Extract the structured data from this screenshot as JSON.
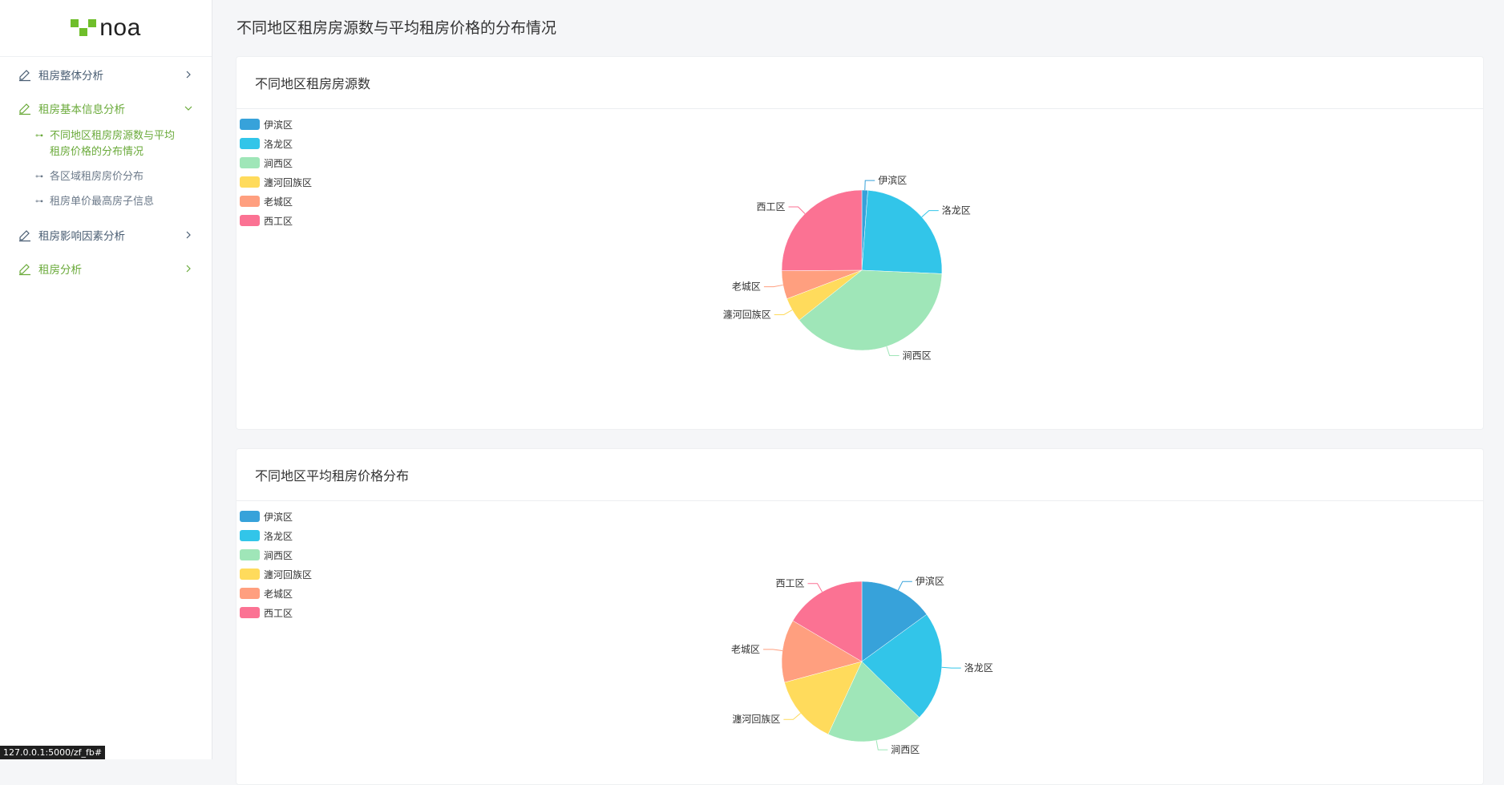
{
  "app": {
    "logo_text": "noa",
    "status_url": "127.0.0.1:5000/zf_fb#"
  },
  "sidebar": {
    "items": [
      {
        "label": "租房整体分析",
        "icon": "edit-icon",
        "chevron": "chevron-right-icon"
      },
      {
        "label": "租房基本信息分析",
        "icon": "edit-icon",
        "chevron": "chevron-down-icon",
        "expanded": true,
        "children": [
          {
            "label": "不同地区租房房源数与平均租房价格的分布情况",
            "active": true
          },
          {
            "label": "各区域租房房价分布"
          },
          {
            "label": "租房单价最高房子信息"
          }
        ]
      },
      {
        "label": "租房影响因素分析",
        "icon": "edit-icon",
        "chevron": "chevron-right-icon"
      },
      {
        "label": "租房分析",
        "icon": "edit-icon",
        "chevron": "chevron-right-icon"
      }
    ]
  },
  "page": {
    "title": "不同地区租房房源数与平均租房价格的分布情况"
  },
  "chart_data": [
    {
      "type": "pie",
      "title": "不同地区租房房源数",
      "legend_position": "top-left",
      "categories": [
        "伊滨区",
        "涧西区",
        "洛龙区",
        "瀍河回族区",
        "老城区",
        "西工区"
      ],
      "legend": [
        "伊滨区",
        "洛龙区",
        "涧西区",
        "瀍河回族区",
        "老城区",
        "西工区"
      ],
      "colors": {
        "伊滨区": "#37a2da",
        "洛龙区": "#32c5e9",
        "涧西区": "#9fe6b8",
        "瀍河回族区": "#ffdb5c",
        "老城区": "#ff9f7f",
        "西工区": "#fb7293"
      },
      "slices": [
        {
          "name": "伊滨区",
          "value": 1.2
        },
        {
          "name": "洛龙区",
          "value": 24.5
        },
        {
          "name": "涧西区",
          "value": 38.6
        },
        {
          "name": "瀍河回族区",
          "value": 4.9
        },
        {
          "name": "老城区",
          "value": 5.7
        },
        {
          "name": "西工区",
          "value": 25.1
        }
      ]
    },
    {
      "type": "pie",
      "title": "不同地区平均租房价格分布",
      "legend_position": "top-left",
      "legend": [
        "伊滨区",
        "洛龙区",
        "涧西区",
        "瀍河回族区",
        "老城区",
        "西工区"
      ],
      "colors": {
        "伊滨区": "#37a2da",
        "洛龙区": "#32c5e9",
        "涧西区": "#9fe6b8",
        "瀍河回族区": "#ffdb5c",
        "老城区": "#ff9f7f",
        "西工区": "#fb7293"
      },
      "slices": [
        {
          "name": "伊滨区",
          "value": 15.0
        },
        {
          "name": "洛龙区",
          "value": 22.3
        },
        {
          "name": "涧西区",
          "value": 19.6
        },
        {
          "name": "瀍河回族区",
          "value": 13.9
        },
        {
          "name": "老城区",
          "value": 12.7
        },
        {
          "name": "西工区",
          "value": 16.5
        }
      ]
    }
  ]
}
